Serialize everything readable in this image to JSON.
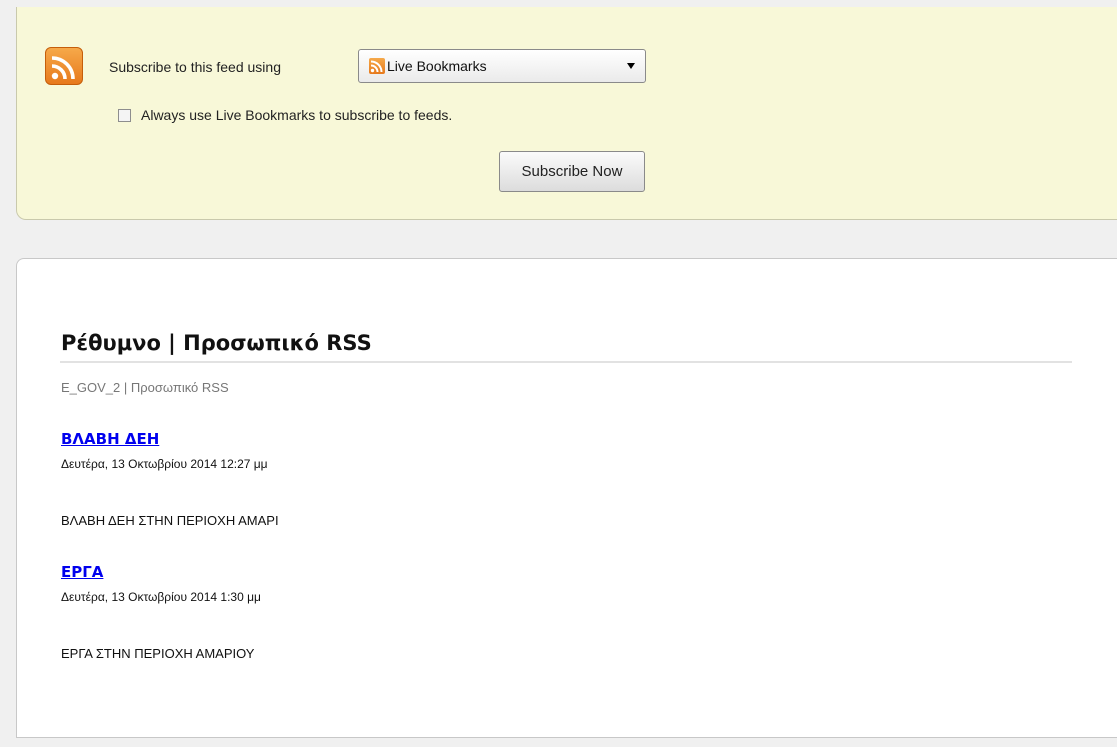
{
  "subscribe": {
    "label": "Subscribe to this feed using",
    "reader": {
      "selected": "Live Bookmarks",
      "icon": "rss-icon"
    },
    "always_checkbox": {
      "label": "Always use Live Bookmarks to subscribe to feeds.",
      "checked": false
    },
    "button": "Subscribe Now"
  },
  "feed": {
    "title": "Ρέθυμνο | Προσωπικό RSS",
    "subtitle": "E_GOV_2 | Προσωπικό RSS",
    "entries": [
      {
        "title": "ΒΛΑΒΗ ΔΕΗ",
        "date": "Δευτέρα, 13 Οκτωβρίου 2014 12:27 μμ",
        "body": "ΒΛΑΒΗ ΔΕΗ ΣΤΗΝ ΠΕΡΙΟΧΗ ΑΜΑΡΙ"
      },
      {
        "title": "ΕΡΓΑ",
        "date": "Δευτέρα, 13 Οκτωβρίου 2014 1:30 μμ",
        "body": "ΕΡΓΑ ΣΤΗΝ ΠΕΡΙΟΧΗ ΑΜΑΡΙΟΥ"
      }
    ]
  },
  "colors": {
    "panel_bg": "#f8f8d8",
    "rss_orange": "#e7791c",
    "link": "#0000ee"
  }
}
